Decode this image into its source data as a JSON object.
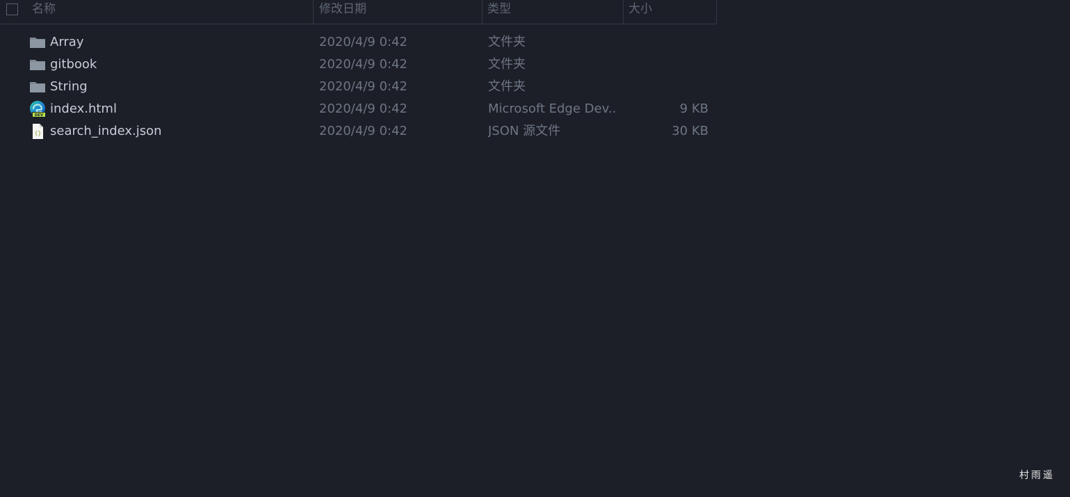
{
  "columns": {
    "name": "名称",
    "date": "修改日期",
    "type": "类型",
    "size": "大小"
  },
  "files": [
    {
      "name": "Array",
      "date": "2020/4/9 0:42",
      "type": "文件夹",
      "size": "",
      "icon": "folder-icon"
    },
    {
      "name": "gitbook",
      "date": "2020/4/9 0:42",
      "type": "文件夹",
      "size": "",
      "icon": "folder-icon"
    },
    {
      "name": "String",
      "date": "2020/4/9 0:42",
      "type": "文件夹",
      "size": "",
      "icon": "folder-icon"
    },
    {
      "name": "index.html",
      "date": "2020/4/9 0:42",
      "type": "Microsoft Edge Dev...",
      "size": "9 KB",
      "icon": "edge-dev-icon"
    },
    {
      "name": "search_index.json",
      "date": "2020/4/9 0:42",
      "type": "JSON 源文件",
      "size": "30 KB",
      "icon": "json-file-icon"
    }
  ],
  "watermark": "村雨遥",
  "colors": {
    "background": "#1c1f27",
    "folder": "#8c97a3",
    "name_text": "#c7ccd6",
    "secondary_text": "#6e7584"
  }
}
